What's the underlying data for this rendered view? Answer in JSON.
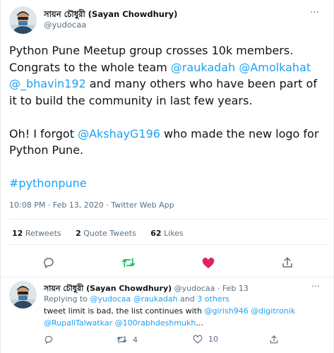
{
  "main_tweet": {
    "author_name": "সায়ন চৌধুরী (Sayan Chowdhury)",
    "author_handle": "@yudocaa",
    "text": {
      "line1": "Python Pune Meetup group crosses 10k members.",
      "line2_prefix": "Congrats to the whole team ",
      "mention_raukadah": "@raukadah",
      "mention_amolkahat": "@Amolkahat",
      "mention_bhavin": "@_bhavin192",
      "line3_suffix": " and many others who have been part of",
      "line4": "it to build the community in last few years.",
      "line5_prefix": "Oh! I forgot ",
      "mention_akshay": "@AkshayG196",
      "line5_suffix": " who made the new logo for",
      "line6": "Python Pune.",
      "hashtag": "#pythonpune"
    },
    "time": "10:08 PM",
    "date": "Feb 13, 2020",
    "source": "Twitter Web App",
    "stats": {
      "retweets_count": "12",
      "retweets_label": "Retweets",
      "quotes_count": "2",
      "quotes_label": "Quote Tweets",
      "likes_count": "62",
      "likes_label": "Likes"
    },
    "liked": true
  },
  "reply_tweet": {
    "author_name": "সায়ন চৌধুরী (Sayan Chowdhury)",
    "author_handle": "@yudocaa",
    "date": "Feb 13",
    "replying_to_label": "Replying to ",
    "replying_to_mentions": "@yudocaa @raukadah",
    "replying_to_and": " and ",
    "replying_to_others": "3 others",
    "text_prefix": "tweet limit is bad, the list continues with ",
    "mention_girish": "@girish946",
    "mention_digitronik": "@digitronik",
    "mention_rupali": "@RupaliTalwatkar",
    "mention_rabh": "@100rabhdeshmukh",
    "text_ellipsis": "...",
    "retweet_count": "4",
    "like_count": "10"
  },
  "colors": {
    "accent": "#1da1f2",
    "retweet_green": "#17bf63",
    "like_pink": "#e0245e",
    "muted": "#5b7083"
  }
}
